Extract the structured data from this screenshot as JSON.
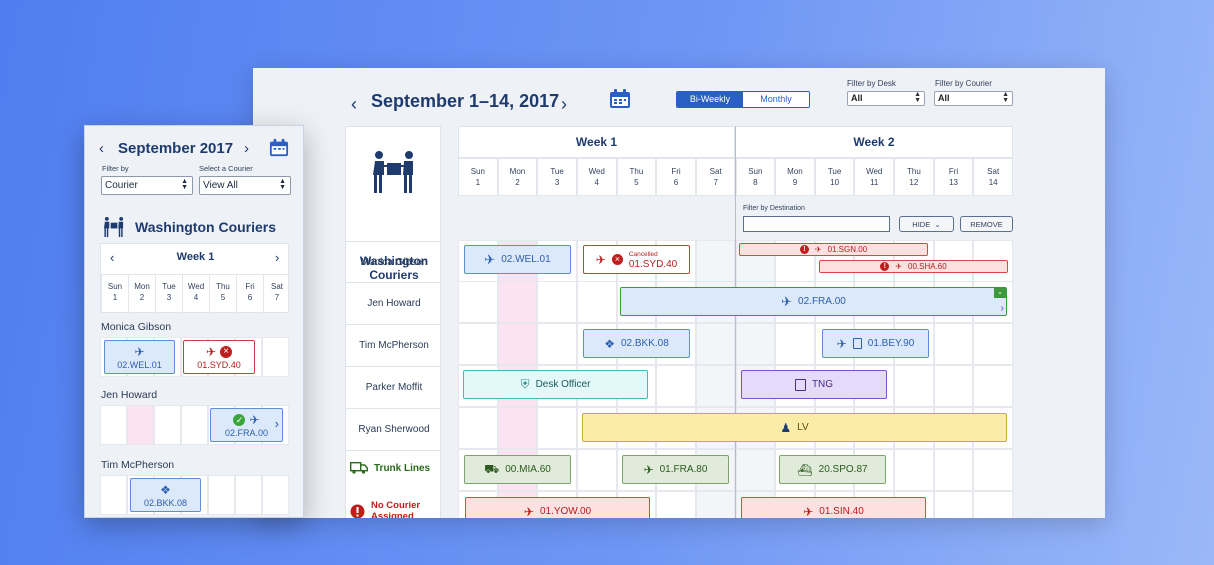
{
  "desktop": {
    "title": "September 1–14, 2017",
    "view_toggle": {
      "biweekly": "Bi-Weekly",
      "monthly": "Monthly",
      "active": "Bi-Weekly"
    },
    "filter_desk": {
      "label": "Filter by Desk",
      "value": "All"
    },
    "filter_courier": {
      "label": "Filter by Courier",
      "value": "All"
    },
    "team_name": "Washington Couriers",
    "weeks": [
      "Week 1",
      "Week 2"
    ],
    "days": [
      {
        "dow": "Sun",
        "num": "1"
      },
      {
        "dow": "Mon",
        "num": "2"
      },
      {
        "dow": "Tue",
        "num": "3"
      },
      {
        "dow": "Wed",
        "num": "4"
      },
      {
        "dow": "Thu",
        "num": "5"
      },
      {
        "dow": "Fri",
        "num": "6"
      },
      {
        "dow": "Sat",
        "num": "7"
      },
      {
        "dow": "Sun",
        "num": "8"
      },
      {
        "dow": "Mon",
        "num": "9"
      },
      {
        "dow": "Tue",
        "num": "10"
      },
      {
        "dow": "Wed",
        "num": "11"
      },
      {
        "dow": "Thu",
        "num": "12"
      },
      {
        "dow": "Fri",
        "num": "13"
      },
      {
        "dow": "Sat",
        "num": "14"
      }
    ],
    "filter_destination": {
      "label": "Filter by Destination",
      "value": ""
    },
    "hide_button": "HIDE",
    "remove_button": "REMOVE",
    "rows": [
      "Monica Gibson",
      "Jen Howard",
      "Tim McPherson",
      "Parker Moffit",
      "Ryan Sherwood"
    ],
    "trunk_lines_label": "Trunk Lines",
    "no_courier_label": "No Courier Assigned",
    "events": {
      "wel01": "02.WEL.01",
      "syd40": "01.SYD.40",
      "syd40_status": "Cancelled",
      "sgn00": "01.SGN.00",
      "sha60": "00.SHA.60",
      "fra00": "02.FRA.00",
      "bkk08": "02.BKK.08",
      "bey90": "01.BEY.90",
      "desk_officer": "Desk Officer",
      "tng": "TNG",
      "lv": "LV",
      "mia60": "00.MIA.60",
      "fra80": "01.FRA.80",
      "spo87": "20.SPO.87",
      "yow00": "01.YOW.00",
      "sin40": "01.SIN.40"
    }
  },
  "mobile": {
    "title": "September 2017",
    "filter_by": {
      "label": "Filter by",
      "value": "Courier"
    },
    "select_courier": {
      "label": "Select a Courier",
      "value": "View All"
    },
    "team_name": "Washington Couriers",
    "week": "Week 1",
    "days": [
      {
        "dow": "Sun",
        "num": "1"
      },
      {
        "dow": "Mon",
        "num": "2"
      },
      {
        "dow": "Tue",
        "num": "3"
      },
      {
        "dow": "Wed",
        "num": "4"
      },
      {
        "dow": "Thu",
        "num": "5"
      },
      {
        "dow": "Fri",
        "num": "6"
      },
      {
        "dow": "Sat",
        "num": "7"
      }
    ],
    "people": [
      "Monica Gibson",
      "Jen Howard",
      "Tim McPherson"
    ],
    "events": {
      "wel01": "02.WEL.01",
      "syd40": "01.SYD.40",
      "fra00": "02.FRA.00",
      "bkk08": "02.BKK.08"
    }
  },
  "colors": {
    "primary": "#2a5fc4",
    "navy": "#1f3b6e",
    "error_red": "#c01d1d",
    "trunk_green": "#2a6b1a",
    "highlight_pink": "#fbe3f3"
  }
}
